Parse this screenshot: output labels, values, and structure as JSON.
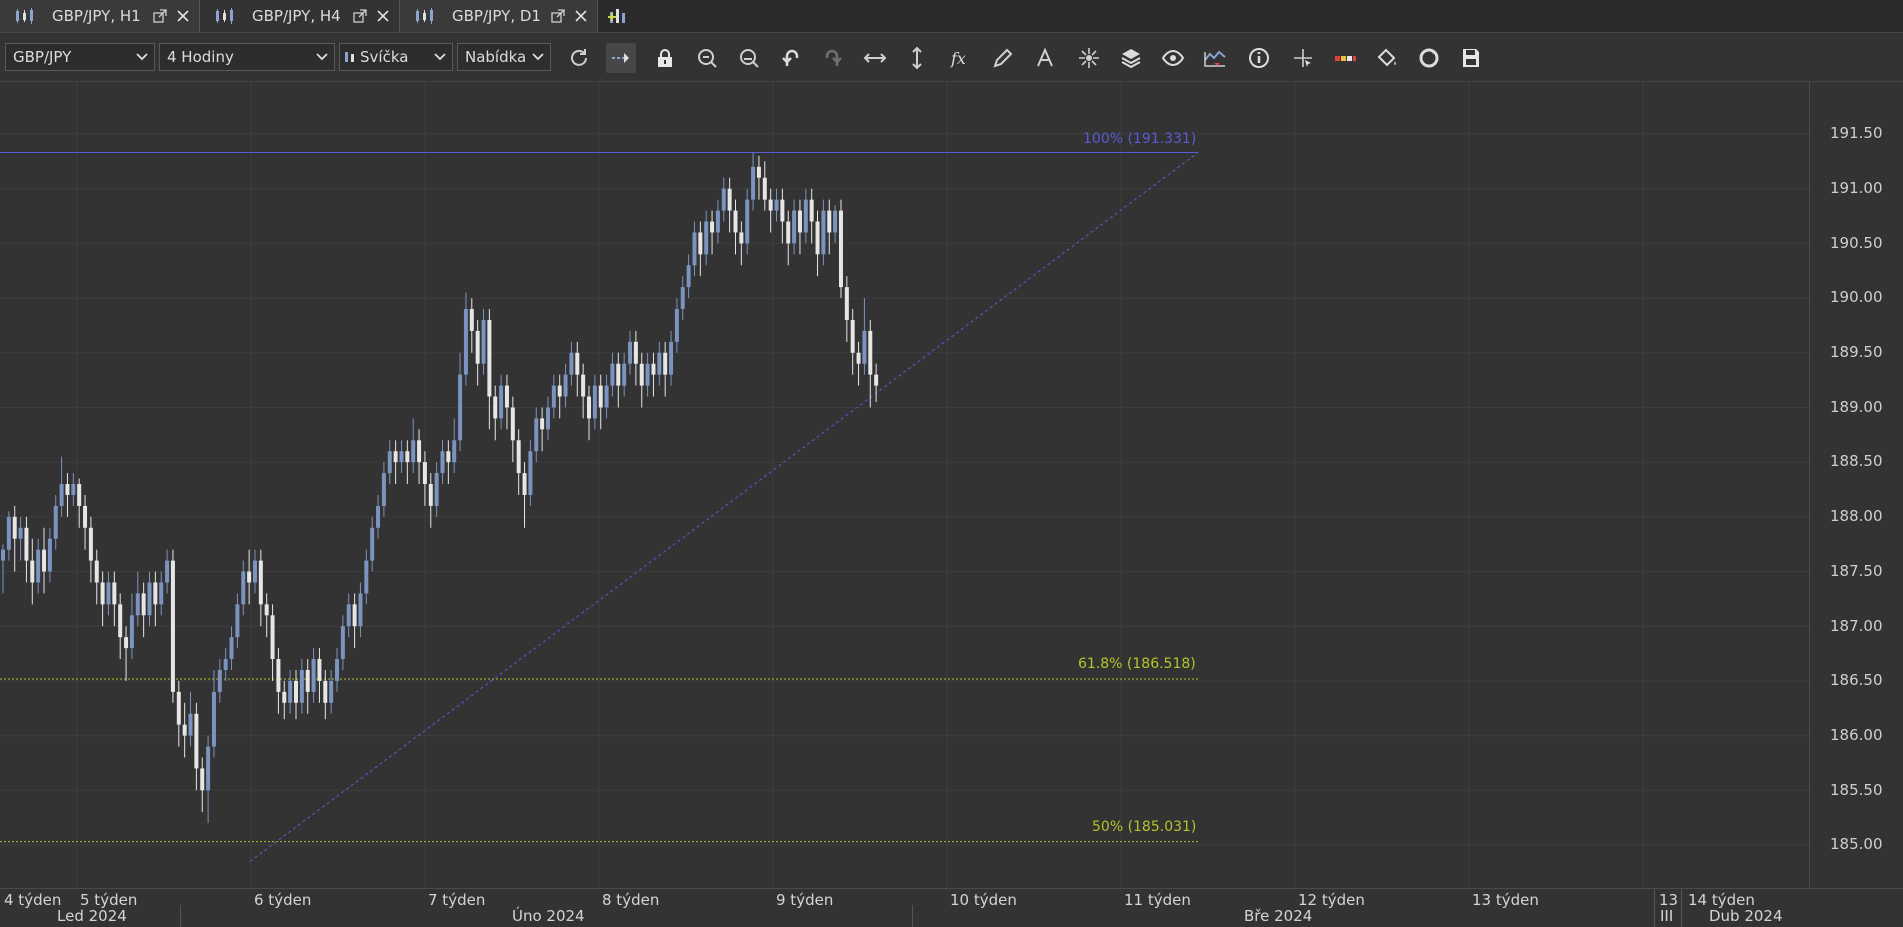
{
  "tabs": [
    {
      "label": "GBP/JPY, H1",
      "active": false
    },
    {
      "label": "GBP/JPY, H4",
      "active": true
    },
    {
      "label": "GBP/JPY, D1",
      "active": false
    }
  ],
  "toolbar": {
    "symbol": "GBP/JPY",
    "timeframe": "4 Hodiny",
    "chart_type": "Svíčka",
    "price_type": "Nabídka"
  },
  "icons": {
    "tab": "candlestick-icon",
    "popout": "popout-icon",
    "close": "close-icon",
    "add_tab": "add-chart-icon",
    "tools": [
      "refresh-icon",
      "auto-scroll-icon",
      "lock-icon",
      "zoom-in-icon",
      "zoom-out-icon",
      "undo-icon",
      "redo-icon",
      "horizontal-scale-icon",
      "vertical-scale-icon",
      "function-icon",
      "pencil-icon",
      "text-tool-icon",
      "crosshair-star-icon",
      "layers-icon",
      "eye-icon",
      "indicator-alert-icon",
      "info-icon",
      "cursor-cross-icon",
      "color-bar-icon",
      "paint-bucket-icon",
      "cycle-icon",
      "save-icon"
    ]
  },
  "chart_data": {
    "type": "candlestick",
    "symbol": "GBP/JPY",
    "ylim": [
      184.6,
      191.9
    ],
    "yticks": [
      "191.50",
      "191.00",
      "190.50",
      "190.00",
      "189.50",
      "189.00",
      "188.50",
      "188.00",
      "187.50",
      "187.00",
      "186.50",
      "186.00",
      "185.50",
      "185.00"
    ],
    "week_labels": [
      "4 týden",
      "5 týden",
      "6 týden",
      "7 týden",
      "8 týden",
      "9 týden",
      "10 týden",
      "11 týden",
      "12 týden",
      "13 týden",
      "13",
      "14 týden"
    ],
    "month_labels": [
      "Led 2024",
      "Úno 2024",
      "Bře 2024",
      "III",
      "Dub 2024"
    ],
    "fibonacci": [
      {
        "label": "100% (191.331)",
        "level": 191.331,
        "color": "#5b5bd6"
      },
      {
        "label": "61.8% (186.518)",
        "level": 186.518,
        "color": "#b5c42a"
      },
      {
        "label": "50% (185.031)",
        "level": 185.031,
        "color": "#b5c42a"
      }
    ],
    "trendline": {
      "from": 184.85,
      "to": 191.331
    },
    "colors": {
      "bull": "#7a94bf",
      "bear": "#e6e6e6",
      "grid": "#3d3d3d"
    },
    "candles": [
      [
        187.6,
        187.7,
        187.3,
        187.75
      ],
      [
        187.7,
        188.0,
        187.6,
        188.05
      ],
      [
        188.0,
        187.8,
        187.5,
        188.1
      ],
      [
        187.8,
        187.9,
        187.6,
        188.0
      ],
      [
        187.9,
        187.6,
        187.4,
        188.0
      ],
      [
        187.6,
        187.4,
        187.2,
        187.8
      ],
      [
        187.4,
        187.7,
        187.3,
        187.8
      ],
      [
        187.7,
        187.5,
        187.3,
        187.9
      ],
      [
        187.5,
        187.8,
        187.4,
        187.9
      ],
      [
        187.8,
        188.1,
        187.7,
        188.2
      ],
      [
        188.1,
        188.3,
        188.0,
        188.55
      ],
      [
        188.3,
        188.2,
        188.0,
        188.4
      ],
      [
        188.2,
        188.3,
        188.1,
        188.4
      ],
      [
        188.3,
        188.1,
        187.9,
        188.35
      ],
      [
        188.1,
        187.9,
        187.7,
        188.2
      ],
      [
        187.9,
        187.6,
        187.4,
        188.0
      ],
      [
        187.6,
        187.4,
        187.2,
        187.7
      ],
      [
        187.4,
        187.2,
        187.0,
        187.5
      ],
      [
        187.2,
        187.4,
        187.1,
        187.5
      ],
      [
        187.4,
        187.2,
        187.0,
        187.5
      ],
      [
        187.2,
        186.9,
        186.7,
        187.3
      ],
      [
        186.9,
        186.8,
        186.5,
        187.0
      ],
      [
        186.8,
        187.1,
        186.7,
        187.3
      ],
      [
        187.1,
        187.3,
        187.0,
        187.5
      ],
      [
        187.3,
        187.1,
        186.9,
        187.4
      ],
      [
        187.1,
        187.4,
        187.0,
        187.5
      ],
      [
        187.4,
        187.2,
        187.0,
        187.5
      ],
      [
        187.2,
        187.4,
        187.1,
        187.5
      ],
      [
        187.4,
        187.6,
        187.3,
        187.7
      ],
      [
        187.6,
        186.4,
        186.3,
        187.7
      ],
      [
        186.4,
        186.1,
        185.9,
        186.5
      ],
      [
        186.1,
        186.0,
        185.8,
        186.3
      ],
      [
        186.0,
        186.2,
        185.9,
        186.4
      ],
      [
        186.2,
        185.7,
        185.5,
        186.3
      ],
      [
        185.7,
        185.5,
        185.3,
        185.8
      ],
      [
        185.5,
        185.9,
        185.2,
        186.0
      ],
      [
        185.9,
        186.4,
        185.8,
        186.6
      ],
      [
        186.4,
        186.6,
        186.3,
        186.7
      ],
      [
        186.6,
        186.7,
        186.5,
        186.8
      ],
      [
        186.7,
        186.9,
        186.6,
        187.0
      ],
      [
        186.9,
        187.2,
        186.8,
        187.3
      ],
      [
        187.2,
        187.5,
        187.1,
        187.6
      ],
      [
        187.5,
        187.4,
        187.2,
        187.7
      ],
      [
        187.4,
        187.6,
        187.3,
        187.7
      ],
      [
        187.6,
        187.2,
        187.0,
        187.7
      ],
      [
        187.2,
        187.1,
        186.9,
        187.3
      ],
      [
        187.1,
        186.7,
        186.5,
        187.2
      ],
      [
        186.7,
        186.4,
        186.2,
        186.8
      ],
      [
        186.4,
        186.3,
        186.15,
        186.5
      ],
      [
        186.3,
        186.5,
        186.2,
        186.6
      ],
      [
        186.5,
        186.3,
        186.15,
        186.6
      ],
      [
        186.3,
        186.6,
        186.2,
        186.7
      ],
      [
        186.6,
        186.4,
        186.2,
        186.7
      ],
      [
        186.4,
        186.7,
        186.3,
        186.8
      ],
      [
        186.7,
        186.5,
        186.3,
        186.8
      ],
      [
        186.5,
        186.3,
        186.15,
        186.6
      ],
      [
        186.3,
        186.5,
        186.2,
        186.6
      ],
      [
        186.5,
        186.7,
        186.4,
        186.8
      ],
      [
        186.7,
        187.0,
        186.6,
        187.1
      ],
      [
        187.0,
        187.2,
        186.9,
        187.3
      ],
      [
        187.2,
        187.0,
        186.8,
        187.3
      ],
      [
        187.0,
        187.3,
        186.9,
        187.4
      ],
      [
        187.3,
        187.6,
        187.2,
        187.7
      ],
      [
        187.6,
        187.9,
        187.5,
        188.0
      ],
      [
        187.9,
        188.1,
        187.8,
        188.2
      ],
      [
        188.1,
        188.4,
        188.0,
        188.5
      ],
      [
        188.4,
        188.6,
        188.3,
        188.7
      ],
      [
        188.6,
        188.5,
        188.3,
        188.7
      ],
      [
        188.5,
        188.6,
        188.4,
        188.7
      ],
      [
        188.6,
        188.5,
        188.3,
        188.7
      ],
      [
        188.5,
        188.7,
        188.4,
        188.9
      ],
      [
        188.7,
        188.5,
        188.3,
        188.8
      ],
      [
        188.5,
        188.3,
        188.1,
        188.6
      ],
      [
        188.3,
        188.1,
        187.9,
        188.4
      ],
      [
        188.1,
        188.4,
        188.0,
        188.5
      ],
      [
        188.4,
        188.6,
        188.3,
        188.7
      ],
      [
        188.6,
        188.5,
        188.3,
        188.7
      ],
      [
        188.5,
        188.7,
        188.4,
        188.9
      ],
      [
        188.7,
        189.3,
        188.6,
        189.5
      ],
      [
        189.3,
        189.9,
        189.2,
        190.05
      ],
      [
        189.9,
        189.7,
        189.5,
        190.0
      ],
      [
        189.7,
        189.4,
        189.2,
        189.8
      ],
      [
        189.4,
        189.8,
        189.3,
        189.9
      ],
      [
        189.8,
        189.1,
        188.8,
        189.9
      ],
      [
        189.1,
        188.9,
        188.7,
        189.2
      ],
      [
        188.9,
        189.2,
        188.8,
        189.3
      ],
      [
        189.2,
        189.0,
        188.8,
        189.3
      ],
      [
        189.0,
        188.7,
        188.5,
        189.1
      ],
      [
        188.7,
        188.4,
        188.2,
        188.8
      ],
      [
        188.4,
        188.2,
        187.9,
        188.5
      ],
      [
        188.2,
        188.6,
        188.1,
        188.7
      ],
      [
        188.6,
        188.9,
        188.5,
        189.0
      ],
      [
        188.9,
        188.8,
        188.6,
        189.0
      ],
      [
        188.8,
        189.0,
        188.7,
        189.1
      ],
      [
        189.0,
        189.2,
        188.9,
        189.3
      ],
      [
        189.2,
        189.1,
        188.9,
        189.3
      ],
      [
        189.1,
        189.3,
        189.0,
        189.4
      ],
      [
        189.3,
        189.5,
        189.2,
        189.6
      ],
      [
        189.5,
        189.3,
        189.1,
        189.6
      ],
      [
        189.3,
        189.1,
        188.9,
        189.4
      ],
      [
        189.1,
        188.9,
        188.7,
        189.2
      ],
      [
        188.9,
        189.2,
        188.8,
        189.3
      ],
      [
        189.2,
        189.0,
        188.8,
        189.3
      ],
      [
        189.0,
        189.2,
        188.9,
        189.3
      ],
      [
        189.2,
        189.4,
        189.1,
        189.5
      ],
      [
        189.4,
        189.2,
        189.0,
        189.5
      ],
      [
        189.2,
        189.4,
        189.1,
        189.5
      ],
      [
        189.4,
        189.6,
        189.3,
        189.7
      ],
      [
        189.6,
        189.4,
        189.2,
        189.7
      ],
      [
        189.4,
        189.2,
        189.0,
        189.5
      ],
      [
        189.2,
        189.4,
        189.1,
        189.5
      ],
      [
        189.4,
        189.3,
        189.1,
        189.5
      ],
      [
        189.3,
        189.5,
        189.2,
        189.6
      ],
      [
        189.5,
        189.3,
        189.1,
        189.6
      ],
      [
        189.3,
        189.6,
        189.2,
        189.7
      ],
      [
        189.6,
        189.9,
        189.5,
        190.0
      ],
      [
        189.9,
        190.1,
        189.8,
        190.2
      ],
      [
        190.1,
        190.3,
        190.0,
        190.4
      ],
      [
        190.3,
        190.6,
        190.2,
        190.7
      ],
      [
        190.6,
        190.4,
        190.2,
        190.7
      ],
      [
        190.4,
        190.7,
        190.3,
        190.8
      ],
      [
        190.7,
        190.6,
        190.4,
        190.8
      ],
      [
        190.6,
        190.8,
        190.5,
        190.9
      ],
      [
        190.8,
        191.0,
        190.7,
        191.1
      ],
      [
        191.0,
        190.8,
        190.6,
        191.1
      ],
      [
        190.8,
        190.6,
        190.4,
        190.9
      ],
      [
        190.6,
        190.5,
        190.3,
        190.7
      ],
      [
        190.5,
        190.9,
        190.4,
        191.0
      ],
      [
        190.9,
        191.2,
        190.8,
        191.33
      ],
      [
        191.2,
        191.1,
        190.9,
        191.3
      ],
      [
        191.1,
        190.9,
        190.8,
        191.25
      ],
      [
        190.9,
        190.8,
        190.6,
        191.0
      ],
      [
        190.8,
        190.9,
        190.7,
        191.0
      ],
      [
        190.9,
        190.7,
        190.5,
        191.0
      ],
      [
        190.7,
        190.5,
        190.3,
        190.8
      ],
      [
        190.5,
        190.8,
        190.4,
        190.9
      ],
      [
        190.8,
        190.6,
        190.4,
        190.9
      ],
      [
        190.6,
        190.9,
        190.5,
        191.0
      ],
      [
        190.9,
        190.7,
        190.5,
        191.0
      ],
      [
        190.7,
        190.4,
        190.2,
        190.8
      ],
      [
        190.4,
        190.8,
        190.3,
        190.9
      ],
      [
        190.8,
        190.6,
        190.4,
        190.9
      ],
      [
        190.6,
        190.8,
        190.5,
        190.85
      ],
      [
        190.8,
        190.1,
        190.0,
        190.9
      ],
      [
        190.1,
        189.8,
        189.6,
        190.2
      ],
      [
        189.8,
        189.5,
        189.3,
        189.9
      ],
      [
        189.5,
        189.4,
        189.2,
        189.6
      ],
      [
        189.4,
        189.7,
        189.3,
        190.0
      ],
      [
        189.7,
        189.3,
        189.0,
        189.8
      ],
      [
        189.3,
        189.2,
        189.05,
        189.4
      ]
    ]
  }
}
